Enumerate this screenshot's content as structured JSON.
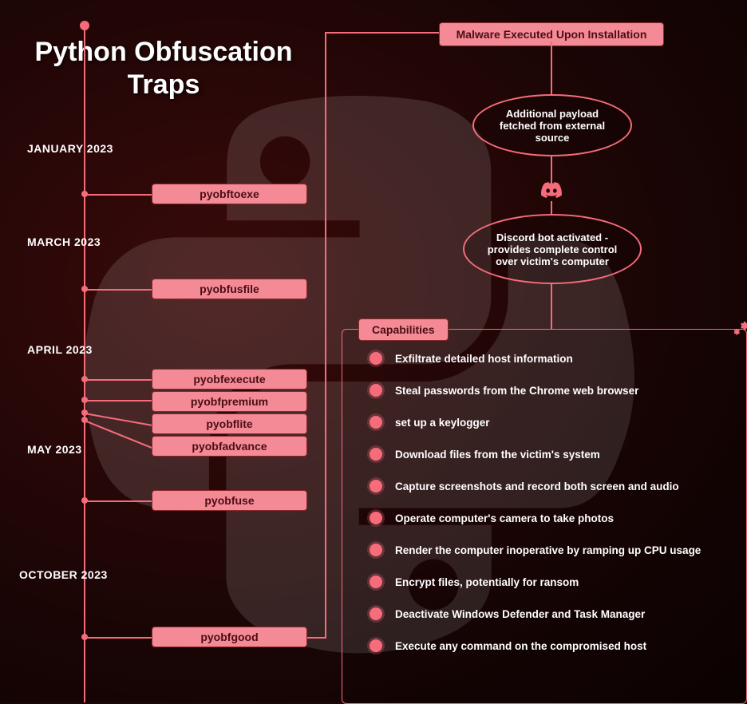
{
  "title_line1": "Python Obfuscation",
  "title_line2": "Traps",
  "months": {
    "jan": "JANUARY 2023",
    "mar": "MARCH 2023",
    "apr": "APRIL 2023",
    "may": "MAY 2023",
    "oct": "OCTOBER 2023"
  },
  "packages": {
    "jan": "pyobftoexe",
    "mar": "pyobfusfile",
    "apr1": "pyobfexecute",
    "apr2": "pyobfpremium",
    "apr3": "pyobflite",
    "apr4": "pyobfadvance",
    "may": "pyobfuse",
    "oct": "pyobfgood"
  },
  "flow": {
    "malware_exec": "Malware Executed Upon Installation",
    "payload": "Additional payload fetched from external source",
    "discord": "Discord bot activated - provides complete control over victim's computer",
    "capabilities_label": "Capabilities"
  },
  "capabilities": [
    "Exfiltrate detailed host information",
    "Steal passwords from the Chrome web browser",
    "set up a keylogger",
    "Download files from the victim's system",
    "Capture screenshots and record both screen and audio",
    "Operate computer's camera to take photos",
    "Render the computer inoperative by ramping up CPU usage",
    "Encrypt files, potentially for ransom",
    "Deactivate Windows Defender and Task Manager",
    "Execute any command on the compromised host"
  ]
}
